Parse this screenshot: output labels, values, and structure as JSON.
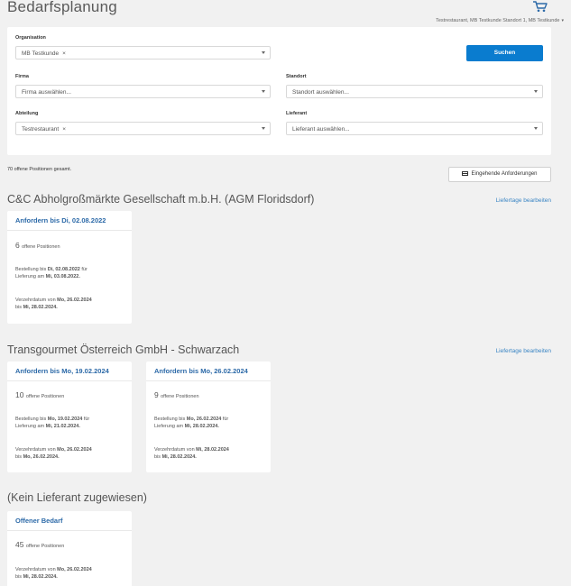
{
  "page": {
    "title": "Bedarfsplanung"
  },
  "header": {
    "user_label": "Testrestaurant, MB Testkunde Standort 1, MB Testkunde"
  },
  "filters": {
    "organisation": {
      "label": "Organisation",
      "value": "MB Testkunde",
      "clear": "×"
    },
    "search_button": "Suchen",
    "firma": {
      "label": "Firma",
      "placeholder": "Firma auswählen..."
    },
    "standort": {
      "label": "Standort",
      "placeholder": "Standort auswählen..."
    },
    "abteilung": {
      "label": "Abteilung",
      "value": "Testrestaurant",
      "clear": "×"
    },
    "lieferant": {
      "label": "Lieferant",
      "placeholder": "Lieferant auswählen..."
    }
  },
  "summary": {
    "total_label": "70 offene Positionen gesamt.",
    "incoming_button": "Eingehende Anforderungen"
  },
  "suppliers": [
    {
      "name": "C&C Abholgroßmärkte Gesellschaft m.b.H. (AGM Floridsdorf)",
      "edit_link": "Liefertage bearbeiten",
      "cards": [
        {
          "title": "Anfordern bis Di, 02.08.2022",
          "count_num": "6",
          "count_text": "offene Positionen",
          "order_prefix": "Bestellung bis ",
          "order_date": "Di, 02.08.2022",
          "order_mid": " für",
          "delivery_prefix": "Lieferung am ",
          "delivery_date": "Mi, 03.08.2022.",
          "consume_prefix": "Verzehrdatum von ",
          "consume_from": "Mo, 26.02.2024",
          "consume_to_prefix": "bis ",
          "consume_to": "Mi, 28.02.2024."
        }
      ]
    },
    {
      "name": "Transgourmet Österreich GmbH - Schwarzach",
      "edit_link": "Liefertage bearbeiten",
      "cards": [
        {
          "title": "Anfordern bis Mo, 19.02.2024",
          "count_num": "10",
          "count_text": "offene Positionen",
          "order_prefix": "Bestellung bis ",
          "order_date": "Mo, 19.02.2024",
          "order_mid": " für",
          "delivery_prefix": "Lieferung am ",
          "delivery_date": "Mi, 21.02.2024.",
          "consume_prefix": "Verzehrdatum von ",
          "consume_from": "Mo, 26.02.2024",
          "consume_to_prefix": "bis ",
          "consume_to": "Mo, 26.02.2024."
        },
        {
          "title": "Anfordern bis Mo, 26.02.2024",
          "count_num": "9",
          "count_text": "offene Positionen",
          "order_prefix": "Bestellung bis ",
          "order_date": "Mo, 26.02.2024",
          "order_mid": " für",
          "delivery_prefix": "Lieferung am ",
          "delivery_date": "Mi, 28.02.2024.",
          "consume_prefix": "Verzehrdatum von ",
          "consume_from": "Mi, 28.02.2024",
          "consume_to_prefix": "bis ",
          "consume_to": "Mi, 28.02.2024."
        }
      ]
    },
    {
      "name": "(Kein Lieferant zugewiesen)",
      "cards": [
        {
          "title": "Offener Bedarf",
          "count_num": "45",
          "count_text": "offene Positionen",
          "consume_prefix": "Verzehrdatum von ",
          "consume_from": "Mo, 26.02.2024",
          "consume_to_prefix": "bis ",
          "consume_to": "Mi, 28.02.2024."
        }
      ]
    }
  ]
}
